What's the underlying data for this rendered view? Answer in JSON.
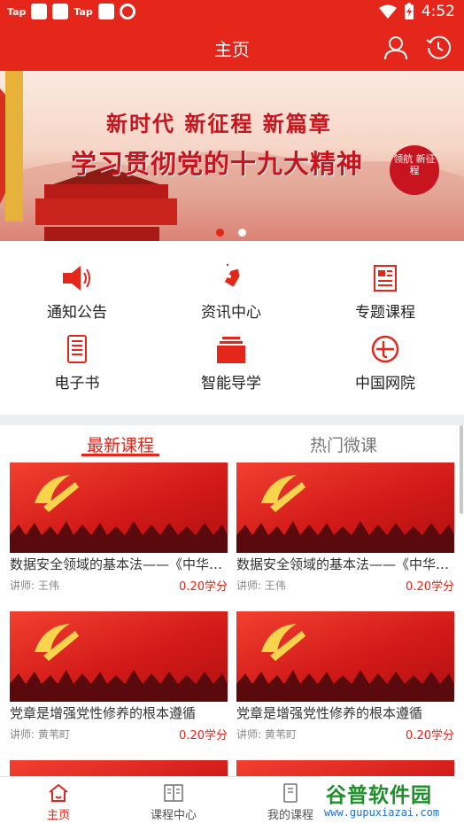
{
  "status_bar": {
    "app_icons": [
      "Tap",
      "Tap"
    ],
    "time": "4:52"
  },
  "header": {
    "title": "主页",
    "icons": [
      "user-icon",
      "history-icon"
    ]
  },
  "banner": {
    "line1": "新时代 新征程 新篇章",
    "line2": "学习贯彻党的十九大精神",
    "seal_text": "领航 新征程",
    "active_slide": 1,
    "slide_count": 2
  },
  "menu": {
    "items": [
      {
        "label": "通知公告",
        "icon": "speaker-icon"
      },
      {
        "label": "资讯中心",
        "icon": "tag-icon"
      },
      {
        "label": "专题课程",
        "icon": "newspaper-icon"
      },
      {
        "label": "电子书",
        "icon": "ebook-icon"
      },
      {
        "label": "智能导学",
        "icon": "folder-stack-icon"
      },
      {
        "label": "中国网院",
        "icon": "globe-logo-icon"
      }
    ]
  },
  "tabs": [
    {
      "label": "最新课程",
      "active": true
    },
    {
      "label": "热门微课",
      "active": false
    }
  ],
  "courses": [
    {
      "title": "数据安全领域的基本法——《中华人民共和国数据安全法》",
      "lecturer": "讲师: 王伟",
      "credit": "0.20学分"
    },
    {
      "title": "数据安全领域的基本法——《中华人民共和国数据安全法》",
      "lecturer": "讲师: 王伟",
      "credit": "0.20学分"
    },
    {
      "title": "党章是增强党性修养的根本遵循",
      "lecturer": "讲师: 黄苇町",
      "credit": "0.20学分"
    },
    {
      "title": "党章是增强党性修养的根本遵循",
      "lecturer": "讲师: 黄苇町",
      "credit": "0.20学分"
    }
  ],
  "bottom_nav": [
    {
      "label": "主页",
      "icon": "home-icon",
      "active": true
    },
    {
      "label": "课程中心",
      "icon": "book-icon",
      "active": false
    },
    {
      "label": "我的课程",
      "icon": "my-course-icon",
      "active": false
    }
  ],
  "watermark": {
    "main": "谷普软件园",
    "sub": "www.gupuxiazai.com"
  },
  "colors": {
    "primary": "#e5261b",
    "background": "#ffffff",
    "divider": "#eceeef"
  }
}
